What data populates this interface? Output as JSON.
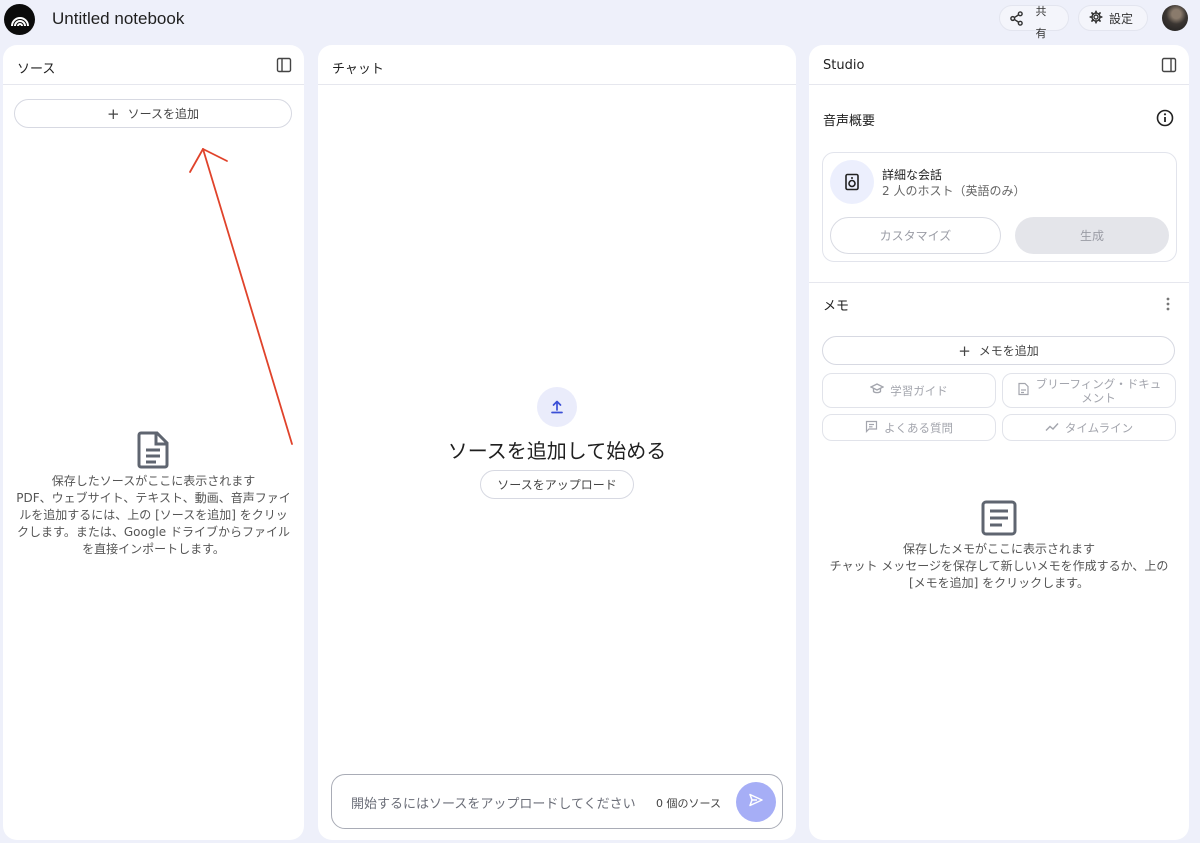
{
  "header": {
    "title": "Untitled notebook",
    "share_label_line1": "共",
    "share_label_line2": "有",
    "settings_label": "設定"
  },
  "sources": {
    "title": "ソース",
    "add_label": "ソースを追加",
    "empty_title": "保存したソースがここに表示されます",
    "empty_line1": "PDF、ウェブサイト、テキスト、動画、音声ファイ",
    "empty_line2": "ルを追加するには、上の [ソースを追加] をクリッ",
    "empty_line3": "クします。または、Google ドライブからファイル",
    "empty_line4": "を直接インポートします。"
  },
  "chat": {
    "title": "チャット",
    "headline": "ソースを追加して始める",
    "upload_label": "ソースをアップロード",
    "input_placeholder": "開始するにはソースをアップロードしてください",
    "source_count": "0 個のソース"
  },
  "studio": {
    "title": "Studio",
    "audio_section_title": "音声概要",
    "audio_card_title": "詳細な会話",
    "audio_card_subtitle": "2 人のホスト（英語のみ）",
    "customize_label": "カスタマイズ",
    "generate_label": "生成",
    "notes_title": "メモ",
    "add_note_label": "メモを追加",
    "study_guide_label": "学習ガイド",
    "briefing_label_line1": "ブリーフィング・ドキュ",
    "briefing_label_line2": "メント",
    "faq_label": "よくある質問",
    "timeline_label": "タイムライン",
    "empty_title": "保存したメモがここに表示されます",
    "empty_line1": "チャット メッセージを保存して新しいメモを作成するか、上の",
    "empty_line2": "[メモを追加] をクリックします。"
  },
  "colors": {
    "background": "#eef0fa",
    "accent": "#a6aef6",
    "annotation_arrow": "#e0432b"
  }
}
